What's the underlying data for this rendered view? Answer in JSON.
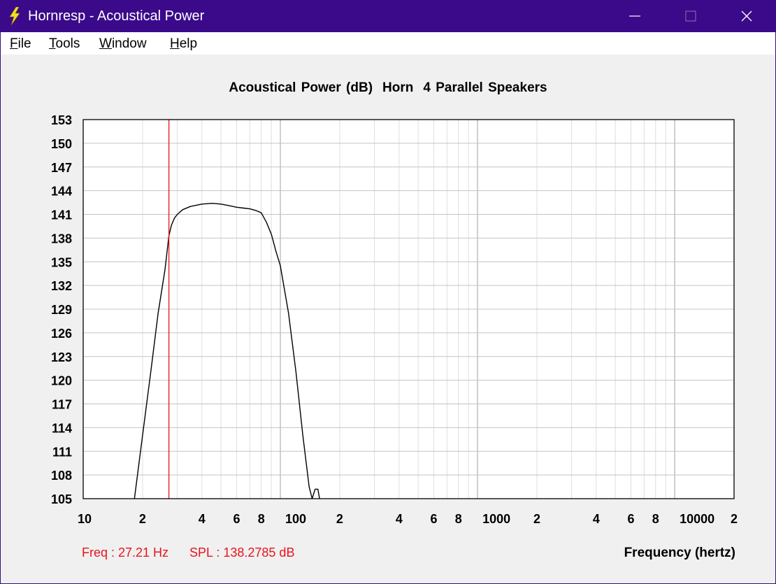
{
  "window": {
    "title": "Hornresp - Acoustical Power",
    "titlebar_color": "#3a0a8a",
    "icon": "lightning-bolt-icon",
    "controls": [
      "minimize-icon",
      "maximize-icon",
      "close-icon"
    ]
  },
  "menu": {
    "file": {
      "first": "F",
      "rest": "ile"
    },
    "tools": {
      "first": "T",
      "rest": "ools"
    },
    "window": {
      "first": "W",
      "rest": "indow"
    },
    "help": {
      "first": "H",
      "rest": "elp"
    }
  },
  "chart_title": {
    "part1": "Acoustical Power (dB)",
    "part2": "Horn",
    "part3": "4 Parallel Speakers"
  },
  "readout": {
    "freq": "Freq : 27.21 Hz",
    "spl": "SPL : 138.2785 dB",
    "color": "#e8141c"
  },
  "chart_data": {
    "type": "line",
    "xlabel": "Frequency (hertz)",
    "ylabel": "",
    "x_scale": "log",
    "xlim": [
      10,
      20000
    ],
    "ylim": [
      105,
      153
    ],
    "grid": true,
    "y_ticks": [
      "153",
      "150",
      "147",
      "144",
      "141",
      "138",
      "135",
      "132",
      "129",
      "126",
      "123",
      "120",
      "117",
      "114",
      "111",
      "108",
      "105"
    ],
    "x_ticks": [
      {
        "value": 10,
        "label": "10"
      },
      {
        "value": 20,
        "label": "2"
      },
      {
        "value": 40,
        "label": "4"
      },
      {
        "value": 60,
        "label": "6"
      },
      {
        "value": 80,
        "label": "8"
      },
      {
        "value": 100,
        "label": "100"
      },
      {
        "value": 200,
        "label": "2"
      },
      {
        "value": 400,
        "label": "4"
      },
      {
        "value": 600,
        "label": "6"
      },
      {
        "value": 800,
        "label": "8"
      },
      {
        "value": 1000,
        "label": "1000"
      },
      {
        "value": 2000,
        "label": "2"
      },
      {
        "value": 4000,
        "label": "4"
      },
      {
        "value": 6000,
        "label": "6"
      },
      {
        "value": 8000,
        "label": "8"
      },
      {
        "value": 10000,
        "label": "10000"
      },
      {
        "value": 20000,
        "label": "2"
      }
    ],
    "marker_freq": 27.21,
    "marker_color": "#e8141c",
    "line_color": "#000000",
    "series": [
      {
        "x": [
          18.2,
          20,
          22,
          24,
          26,
          27.21,
          28,
          29,
          30,
          32,
          35,
          40,
          45,
          50,
          55,
          60,
          65,
          70,
          75,
          80,
          85,
          90,
          95,
          100,
          110,
          120,
          130,
          140,
          145
        ],
        "y": [
          105,
          113,
          121,
          128.5,
          134,
          138.28,
          139.6,
          140.5,
          141.0,
          141.6,
          142.0,
          142.3,
          142.4,
          142.3,
          142.1,
          141.9,
          141.8,
          141.7,
          141.5,
          141.2,
          140.0,
          138.5,
          136.3,
          134.5,
          128.5,
          121.0,
          113.0,
          106.5,
          105
        ]
      },
      {
        "x": [
          145,
          150,
          155,
          158
        ],
        "y": [
          105,
          106.2,
          106.2,
          105
        ]
      }
    ]
  }
}
